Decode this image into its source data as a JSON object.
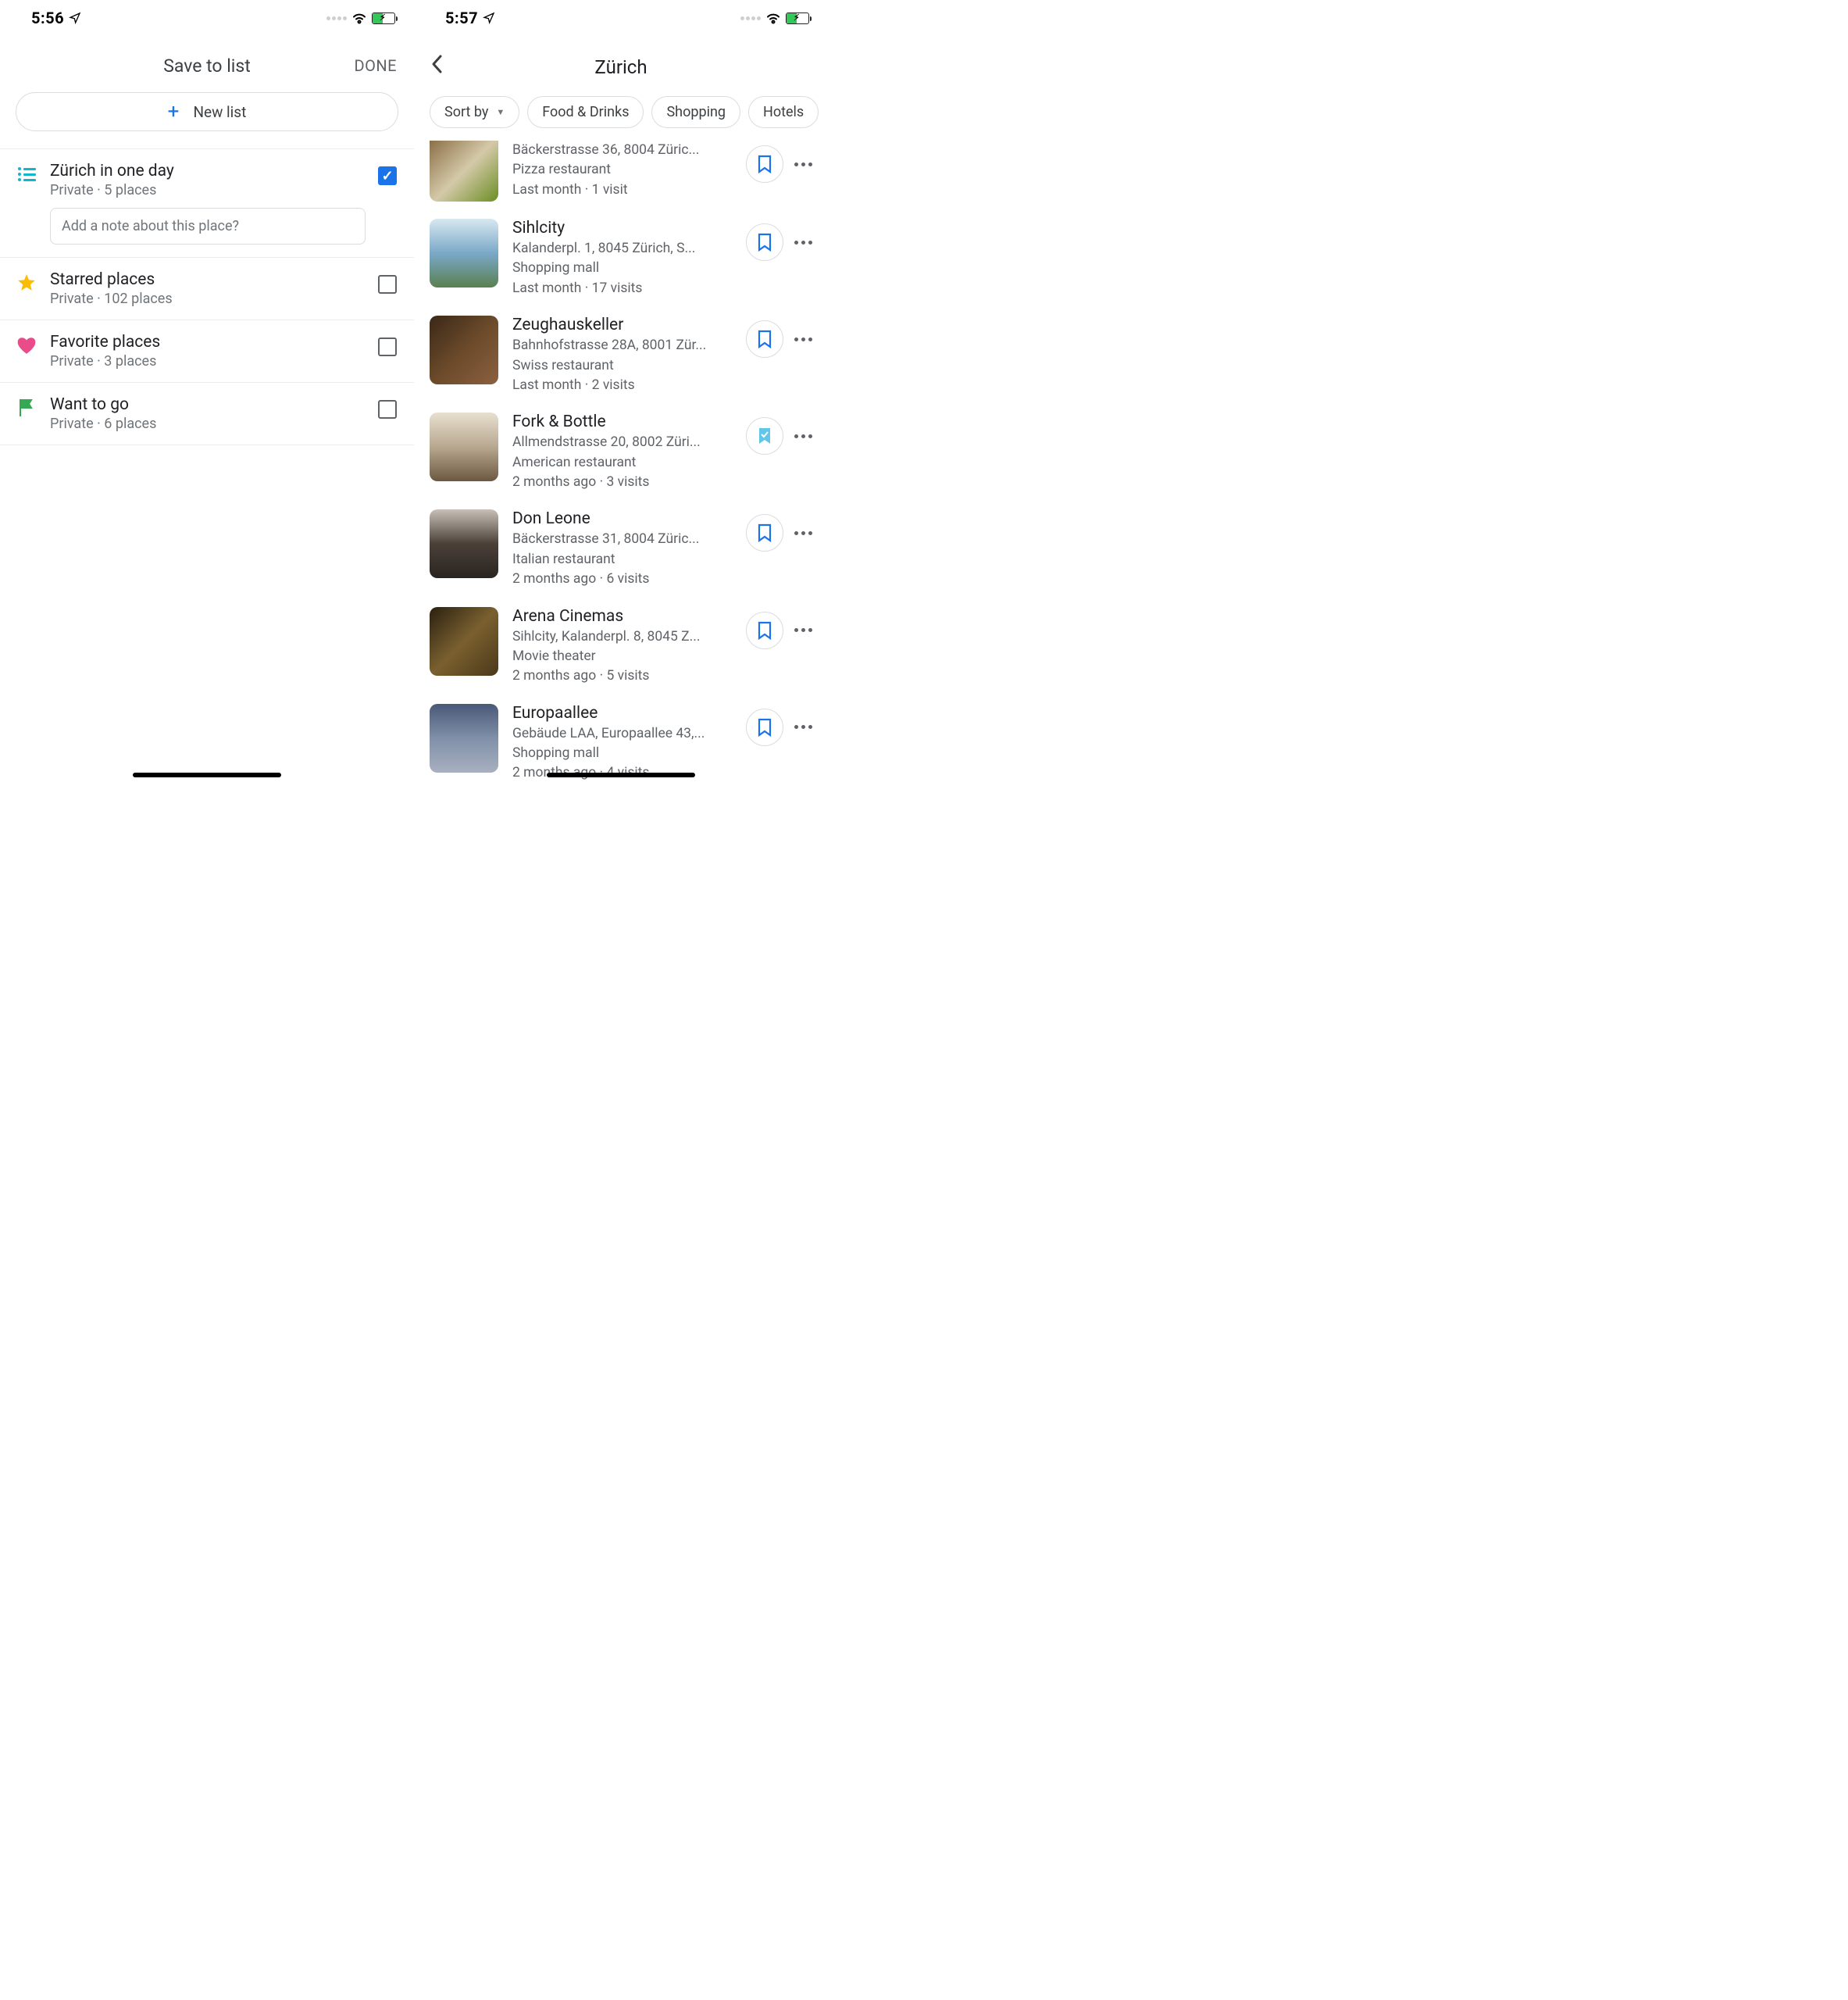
{
  "left": {
    "status_time": "5:56",
    "header_title": "Save to list",
    "done_label": "DONE",
    "new_list_label": "New list",
    "lists": [
      {
        "name": "Zürich in one day",
        "meta": "Private · 5 places",
        "checked": true,
        "note_placeholder": "Add a note about this place?"
      },
      {
        "name": "Starred places",
        "meta": "Private · 102 places",
        "checked": false
      },
      {
        "name": "Favorite places",
        "meta": "Private · 3 places",
        "checked": false
      },
      {
        "name": "Want to go",
        "meta": "Private · 6 places",
        "checked": false
      }
    ]
  },
  "right": {
    "status_time": "5:57",
    "city_title": "Zürich",
    "chips": {
      "sort": "Sort by",
      "c1": "Food & Drinks",
      "c2": "Shopping",
      "c3": "Hotels"
    },
    "places": [
      {
        "address": "Bäckerstrasse 36, 8004 Züric...",
        "type": "Pizza restaurant",
        "visits": "Last month · 1 visit",
        "saved": "unsaved"
      },
      {
        "name": "Sihlcity",
        "address": "Kalanderpl. 1, 8045 Zürich, S...",
        "type": "Shopping mall",
        "visits": "Last month · 17 visits",
        "saved": "unsaved"
      },
      {
        "name": "Zeughauskeller",
        "address": "Bahnhofstrasse 28A, 8001 Zür...",
        "type": "Swiss restaurant",
        "visits": "Last month · 2 visits",
        "saved": "unsaved"
      },
      {
        "name": "Fork & Bottle",
        "address": "Allmendstrasse 20, 8002 Züri...",
        "type": "American restaurant",
        "visits": "2 months ago · 3 visits",
        "saved": "saved"
      },
      {
        "name": "Don Leone",
        "address": "Bäckerstrasse 31, 8004 Züric...",
        "type": "Italian restaurant",
        "visits": "2 months ago · 6 visits",
        "saved": "unsaved"
      },
      {
        "name": "Arena Cinemas",
        "address": "Sihlcity, Kalanderpl. 8, 8045 Z...",
        "type": "Movie theater",
        "visits": "2 months ago · 5 visits",
        "saved": "unsaved"
      },
      {
        "name": "Europaallee",
        "address": "Gebäude LAA, Europaallee 43,...",
        "type": "Shopping mall",
        "visits": "2 months ago · 4 visits",
        "saved": "unsaved"
      }
    ]
  }
}
